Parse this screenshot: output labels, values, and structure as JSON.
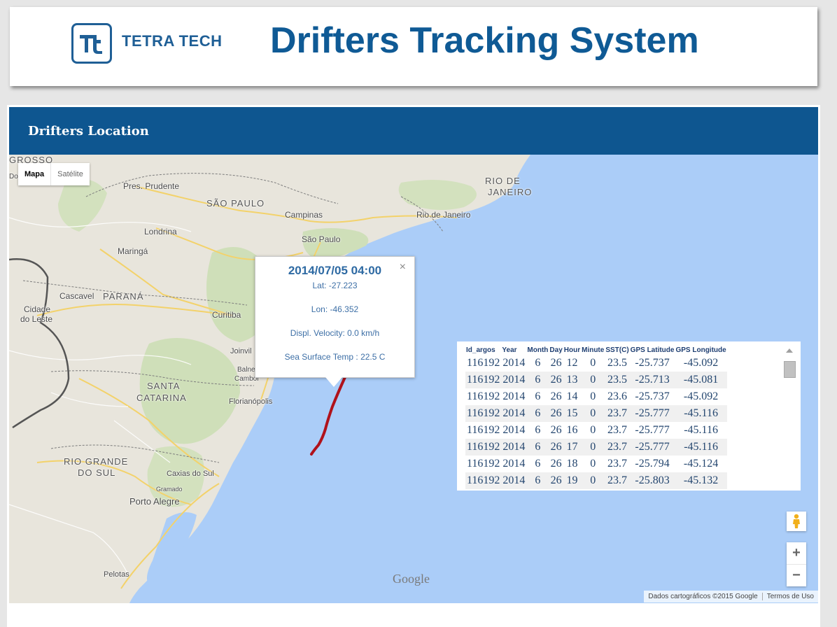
{
  "header": {
    "logo_text": "TETRA TECH",
    "title": "Drifters Tracking System"
  },
  "panel": {
    "title": "Drifters Location"
  },
  "map": {
    "maptype": {
      "map": "Mapa",
      "satellite": "Satélite"
    },
    "labels": {
      "grosso": "GROSSO",
      "dourados": "Dourados",
      "pres_prudente": "Pres. Prudente",
      "sao_paulo_state": "SÃO PAULO",
      "rio_state_1": "RIO DE",
      "rio_state_2": "JANEIRO",
      "campinas": "Campinas",
      "rio_city": "Rio de Janeiro",
      "londrina": "Londrina",
      "maringa": "Maringá",
      "sao_paulo_city": "São Paulo",
      "cascavel": "Cascavel",
      "parana": "PARANÁ",
      "cidade_1": "Cidade",
      "cidade_2": "do Leste",
      "curitiba": "Curitiba",
      "joinville": "Joinvil",
      "balneario": "Balne",
      "camboriu": "Cambor",
      "santa_1": "SANTA",
      "santa_2": "CATARINA",
      "florianopolis": "Florianópolis",
      "rio_grande_1": "RIO GRANDE",
      "rio_grande_2": "DO SUL",
      "caxias": "Caxias do Sul",
      "gramado": "Gramado",
      "porto_alegre": "Porto Alegre",
      "pelotas": "Pelotas"
    },
    "popup": {
      "title": "2014/07/05 04:00",
      "close": "×",
      "lat": "Lat: -27.223",
      "lon": "Lon: -46.352",
      "velocity": "Displ. Velocity: 0.0 km/h",
      "temp": "Sea Surface Temp : 22.5 C"
    },
    "table": {
      "headers": [
        "Id_argos",
        "Year",
        "Month",
        "Day",
        "Hour",
        "Minute",
        "SST(C)",
        "GPS Latitude",
        "GPS Longitude"
      ],
      "rows": [
        [
          "116192",
          "2014",
          "6",
          "26",
          "12",
          "0",
          "23.5",
          "-25.737",
          "-45.092"
        ],
        [
          "116192",
          "2014",
          "6",
          "26",
          "13",
          "0",
          "23.5",
          "-25.713",
          "-45.081"
        ],
        [
          "116192",
          "2014",
          "6",
          "26",
          "14",
          "0",
          "23.6",
          "-25.737",
          "-45.092"
        ],
        [
          "116192",
          "2014",
          "6",
          "26",
          "15",
          "0",
          "23.7",
          "-25.777",
          "-45.116"
        ],
        [
          "116192",
          "2014",
          "6",
          "26",
          "16",
          "0",
          "23.7",
          "-25.777",
          "-45.116"
        ],
        [
          "116192",
          "2014",
          "6",
          "26",
          "17",
          "0",
          "23.7",
          "-25.777",
          "-45.116"
        ],
        [
          "116192",
          "2014",
          "6",
          "26",
          "18",
          "0",
          "23.7",
          "-25.794",
          "-45.124"
        ],
        [
          "116192",
          "2014",
          "6",
          "26",
          "19",
          "0",
          "23.7",
          "-25.803",
          "-45.132"
        ]
      ]
    },
    "zoom_in": "+",
    "zoom_out": "−",
    "google": "Google",
    "attribution": "Dados cartográficos ©2015 Google",
    "terms": "Termos de Uso"
  },
  "colors": {
    "brand_blue": "#0e5690",
    "track": "#b0121b",
    "ocean": "#abcdf8",
    "land": "#e9e5dc"
  },
  "icons": [
    "tetra-tech-logo-icon",
    "pegman-icon",
    "scroll-up-icon"
  ]
}
